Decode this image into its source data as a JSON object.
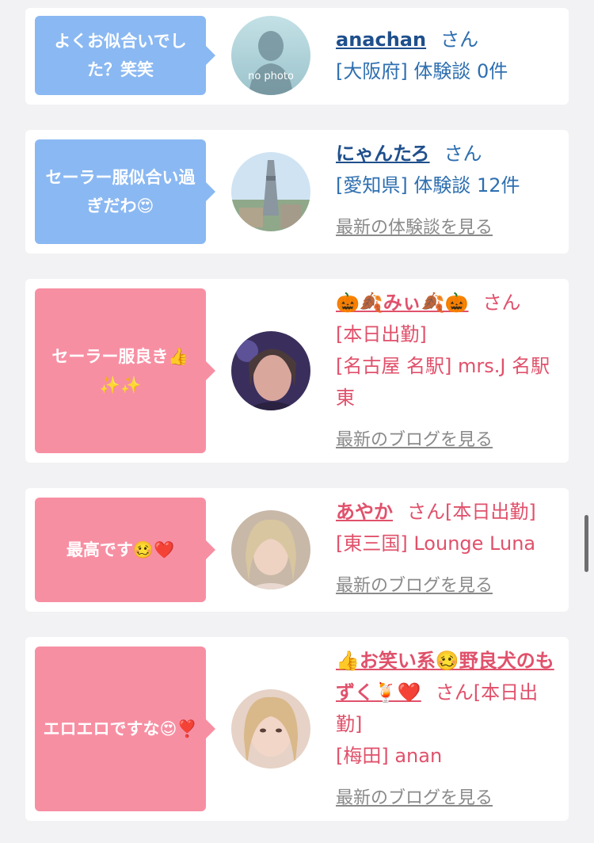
{
  "comments": [
    {
      "comment": "よくお似合いでした？笑笑",
      "name": "anachan",
      "honorific": "さん",
      "line1": "[大阪府] 体験談 0件",
      "link": "",
      "photo_label": "no photo"
    },
    {
      "comment": "セーラー服似合い過ぎだわ😍",
      "name": "にゃんたろ",
      "honorific": "さん",
      "line1": "[愛知県] 体験談 12件",
      "link": "最新の体験談を見る"
    },
    {
      "comment": "セーラー服良き👍✨✨",
      "name": "🎃🍂みぃ🍂🎃",
      "honorific": "さん",
      "line1": "[本日出勤]",
      "line2": "[名古屋 名駅] mrs.J 名駅東",
      "link": "最新のブログを見る"
    },
    {
      "comment": "最高です🥴❤️",
      "name": "あやか",
      "honorific": "さん[本日出勤]",
      "line1": "[東三国] Lounge Luna",
      "link": "最新のブログを見る"
    },
    {
      "comment": "エロエロですな😍❣️",
      "name": "👍お笑い系🥴野良犬のもずく🍹❤️",
      "honorific": "さん[本日出勤]",
      "line1": "[梅田] anan",
      "link": "最新のブログを見る"
    }
  ],
  "colors": {
    "user_bubble": "#8ab8f2",
    "cast_bubble": "#f78fa3",
    "user_text": "#2e6fb0",
    "cast_text": "#e0516b",
    "link_gray": "#8a8a8a",
    "background": "#f2f2f4"
  }
}
